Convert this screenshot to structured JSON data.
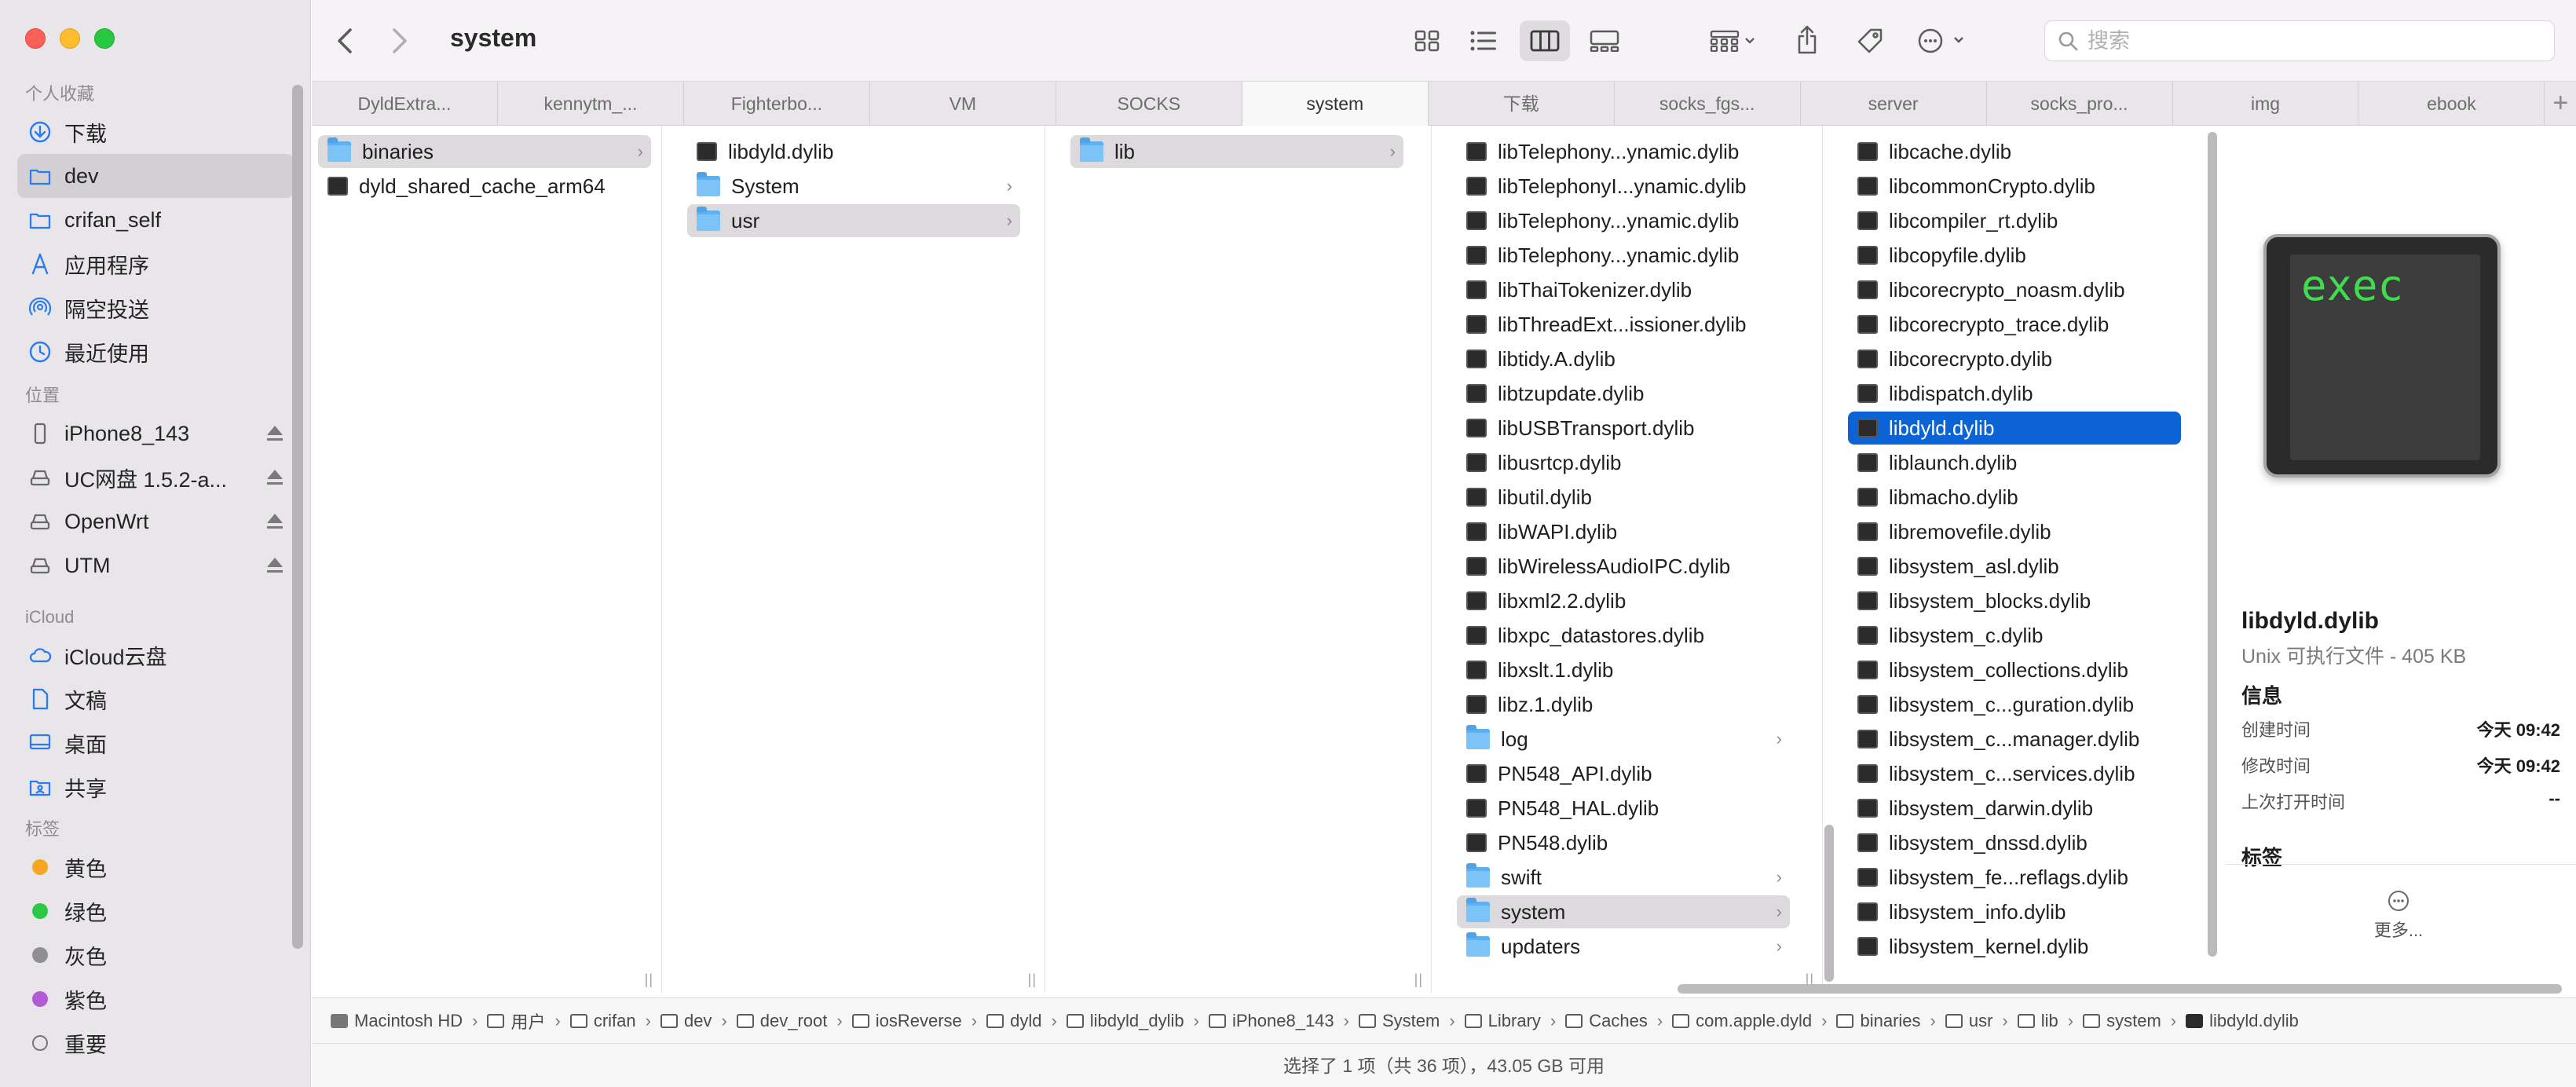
{
  "window": {
    "title": "system"
  },
  "sidebar": {
    "sections": [
      {
        "heading": "个人收藏",
        "items": [
          {
            "label": "下载",
            "icon": "download-icon"
          },
          {
            "label": "dev",
            "icon": "folder-icon",
            "selected": true
          },
          {
            "label": "crifan_self",
            "icon": "folder-icon"
          },
          {
            "label": "应用程序",
            "icon": "applications-icon"
          },
          {
            "label": "隔空投送",
            "icon": "airdrop-icon"
          },
          {
            "label": "最近使用",
            "icon": "recents-icon"
          }
        ]
      },
      {
        "heading": "位置",
        "items": [
          {
            "label": "iPhone8_143",
            "icon": "iphone-icon",
            "eject": true
          },
          {
            "label": "UC网盘 1.5.2-a...",
            "icon": "drive-icon",
            "eject": true
          },
          {
            "label": "OpenWrt",
            "icon": "drive-icon",
            "eject": true
          },
          {
            "label": "UTM",
            "icon": "drive-icon",
            "eject": true
          }
        ]
      },
      {
        "heading": "iCloud",
        "items": [
          {
            "label": "iCloud云盘",
            "icon": "icloud-icon"
          },
          {
            "label": "文稿",
            "icon": "document-icon"
          },
          {
            "label": "桌面",
            "icon": "desktop-icon"
          },
          {
            "label": "共享",
            "icon": "shared-folder-icon"
          }
        ]
      },
      {
        "heading": "标签",
        "items": [
          {
            "label": "黄色",
            "color": "#f5a623"
          },
          {
            "label": "绿色",
            "color": "#2ac845"
          },
          {
            "label": "灰色",
            "color": "#8e8e93"
          },
          {
            "label": "紫色",
            "color": "#b45ad6"
          },
          {
            "label": "重要",
            "color": "hollow"
          }
        ]
      }
    ]
  },
  "toolbar": {
    "title": "system",
    "search_placeholder": "搜索"
  },
  "tabs": [
    {
      "label": "DyldExtra..."
    },
    {
      "label": "kennytm_..."
    },
    {
      "label": "Fighterbo..."
    },
    {
      "label": "VM"
    },
    {
      "label": "SOCKS"
    },
    {
      "label": "system",
      "active": true
    },
    {
      "label": "下载"
    },
    {
      "label": "socks_fgs..."
    },
    {
      "label": "server"
    },
    {
      "label": "socks_pro..."
    },
    {
      "label": "img"
    },
    {
      "label": "ebook"
    }
  ],
  "columns": [
    {
      "rows": [
        {
          "name": "binaries",
          "type": "folder",
          "chevron": true,
          "selected": "gray"
        },
        {
          "name": "dyld_shared_cache_arm64",
          "type": "exec"
        }
      ]
    },
    {
      "rows": [
        {
          "name": "libdyld.dylib",
          "type": "exec"
        },
        {
          "name": "System",
          "type": "folder",
          "chevron": true
        },
        {
          "name": "usr",
          "type": "folder",
          "chevron": true,
          "selected": "gray"
        }
      ]
    },
    {
      "rows": [
        {
          "name": "lib",
          "type": "folder",
          "chevron": true,
          "selected": "gray"
        }
      ]
    },
    {
      "rows": [
        {
          "name": "libTelephony...ynamic.dylib",
          "type": "exec"
        },
        {
          "name": "libTelephonyI...ynamic.dylib",
          "type": "exec"
        },
        {
          "name": "libTelephony...ynamic.dylib",
          "type": "exec"
        },
        {
          "name": "libTelephony...ynamic.dylib",
          "type": "exec"
        },
        {
          "name": "libThaiTokenizer.dylib",
          "type": "exec"
        },
        {
          "name": "libThreadExt...issioner.dylib",
          "type": "exec"
        },
        {
          "name": "libtidy.A.dylib",
          "type": "exec"
        },
        {
          "name": "libtzupdate.dylib",
          "type": "exec"
        },
        {
          "name": "libUSBTransport.dylib",
          "type": "exec"
        },
        {
          "name": "libusrtcp.dylib",
          "type": "exec"
        },
        {
          "name": "libutil.dylib",
          "type": "exec"
        },
        {
          "name": "libWAPI.dylib",
          "type": "exec"
        },
        {
          "name": "libWirelessAudioIPC.dylib",
          "type": "exec"
        },
        {
          "name": "libxml2.2.dylib",
          "type": "exec"
        },
        {
          "name": "libxpc_datastores.dylib",
          "type": "exec"
        },
        {
          "name": "libxslt.1.dylib",
          "type": "exec"
        },
        {
          "name": "libz.1.dylib",
          "type": "exec"
        },
        {
          "name": "log",
          "type": "folder",
          "chevron": true
        },
        {
          "name": "PN548_API.dylib",
          "type": "exec"
        },
        {
          "name": "PN548_HAL.dylib",
          "type": "exec"
        },
        {
          "name": "PN548.dylib",
          "type": "exec"
        },
        {
          "name": "swift",
          "type": "folder",
          "chevron": true
        },
        {
          "name": "system",
          "type": "folder",
          "chevron": true,
          "selected": "gray"
        },
        {
          "name": "updaters",
          "type": "folder",
          "chevron": true
        }
      ]
    },
    {
      "rows": [
        {
          "name": "libcache.dylib",
          "type": "exec"
        },
        {
          "name": "libcommonCrypto.dylib",
          "type": "exec"
        },
        {
          "name": "libcompiler_rt.dylib",
          "type": "exec"
        },
        {
          "name": "libcopyfile.dylib",
          "type": "exec"
        },
        {
          "name": "libcorecrypto_noasm.dylib",
          "type": "exec"
        },
        {
          "name": "libcorecrypto_trace.dylib",
          "type": "exec"
        },
        {
          "name": "libcorecrypto.dylib",
          "type": "exec"
        },
        {
          "name": "libdispatch.dylib",
          "type": "exec"
        },
        {
          "name": "libdyld.dylib",
          "type": "exec",
          "selected": "blue"
        },
        {
          "name": "liblaunch.dylib",
          "type": "exec"
        },
        {
          "name": "libmacho.dylib",
          "type": "exec"
        },
        {
          "name": "libremovefile.dylib",
          "type": "exec"
        },
        {
          "name": "libsystem_asl.dylib",
          "type": "exec"
        },
        {
          "name": "libsystem_blocks.dylib",
          "type": "exec"
        },
        {
          "name": "libsystem_c.dylib",
          "type": "exec"
        },
        {
          "name": "libsystem_collections.dylib",
          "type": "exec"
        },
        {
          "name": "libsystem_c...guration.dylib",
          "type": "exec"
        },
        {
          "name": "libsystem_c...manager.dylib",
          "type": "exec"
        },
        {
          "name": "libsystem_c...services.dylib",
          "type": "exec"
        },
        {
          "name": "libsystem_darwin.dylib",
          "type": "exec"
        },
        {
          "name": "libsystem_dnssd.dylib",
          "type": "exec"
        },
        {
          "name": "libsystem_fe...reflags.dylib",
          "type": "exec"
        },
        {
          "name": "libsystem_info.dylib",
          "type": "exec"
        },
        {
          "name": "libsystem_kernel.dylib",
          "type": "exec"
        }
      ]
    }
  ],
  "preview": {
    "icon_text": "exec",
    "name": "libdyld.dylib",
    "kind": "Unix 可执行文件 - 405 KB",
    "info_heading": "信息",
    "info": [
      {
        "key": "创建时间",
        "value": "今天 09:42"
      },
      {
        "key": "修改时间",
        "value": "今天 09:42"
      },
      {
        "key": "上次打开时间",
        "value": "--"
      }
    ],
    "tags_heading": "标签",
    "more_label": "更多..."
  },
  "pathbar": [
    {
      "label": "Macintosh HD",
      "icon": "hd"
    },
    {
      "label": "用户",
      "icon": "folder"
    },
    {
      "label": "crifan",
      "icon": "folder"
    },
    {
      "label": "dev",
      "icon": "folder"
    },
    {
      "label": "dev_root",
      "icon": "folder"
    },
    {
      "label": "iosReverse",
      "icon": "folder"
    },
    {
      "label": "dyld",
      "icon": "folder"
    },
    {
      "label": "libdyld_dylib",
      "icon": "folder"
    },
    {
      "label": "iPhone8_143",
      "icon": "folder"
    },
    {
      "label": "System",
      "icon": "folder"
    },
    {
      "label": "Library",
      "icon": "folder"
    },
    {
      "label": "Caches",
      "icon": "folder"
    },
    {
      "label": "com.apple.dyld",
      "icon": "folder"
    },
    {
      "label": "binaries",
      "icon": "folder"
    },
    {
      "label": "usr",
      "icon": "folder"
    },
    {
      "label": "lib",
      "icon": "folder"
    },
    {
      "label": "system",
      "icon": "folder"
    },
    {
      "label": "libdyld.dylib",
      "icon": "exec"
    }
  ],
  "status": "选择了 1 项（共 36 项），43.05 GB 可用"
}
